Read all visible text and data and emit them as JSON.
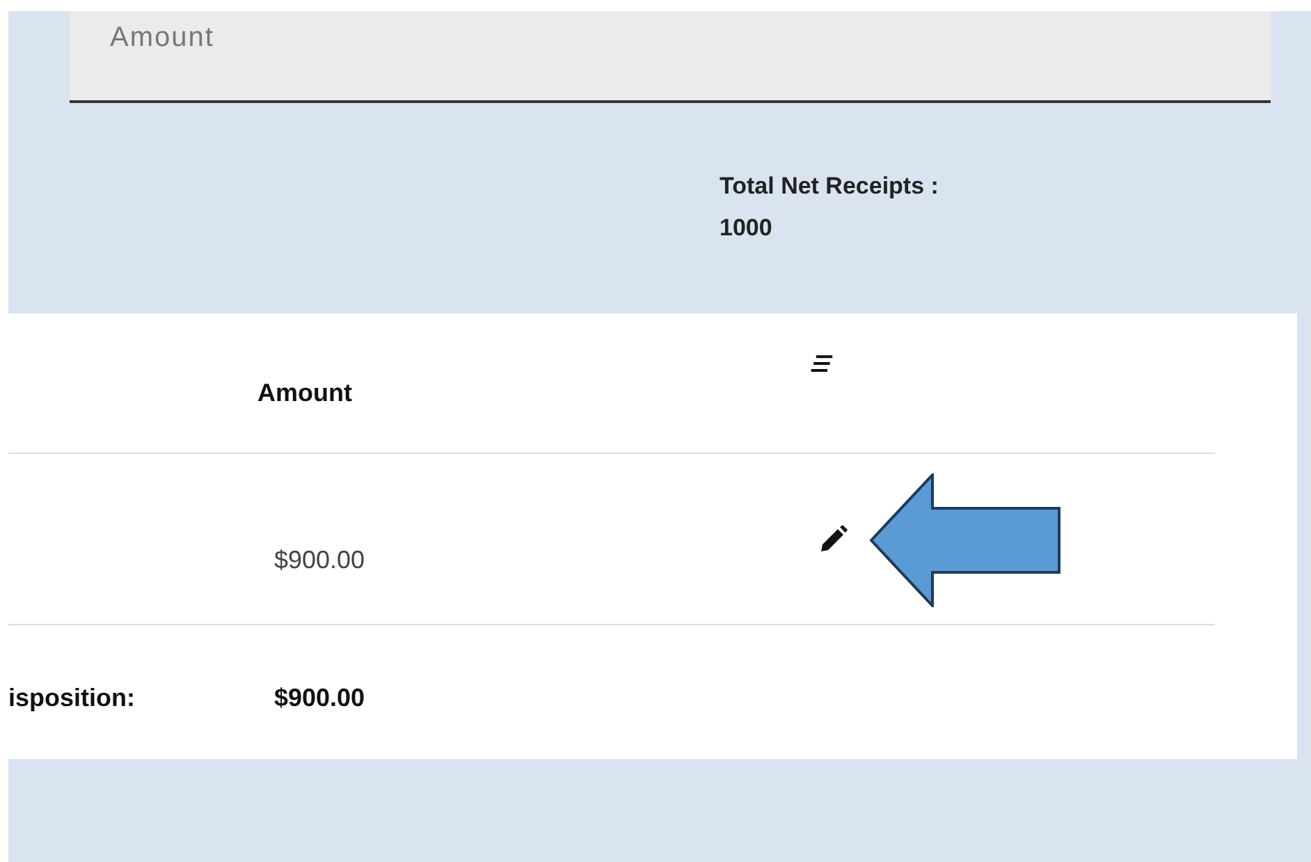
{
  "amount_field": {
    "placeholder": "Amount"
  },
  "total_net_receipts": {
    "label": "Total Net Receipts :",
    "value": "1000"
  },
  "table": {
    "columns": [
      {
        "kind": "blank"
      },
      {
        "kind": "text",
        "label": "Amount"
      },
      {
        "kind": "menu"
      }
    ],
    "rows": [
      {
        "amount": "$900.00",
        "editable": true
      }
    ],
    "footer": {
      "label": "isposition:",
      "amount": "$900.00"
    }
  }
}
